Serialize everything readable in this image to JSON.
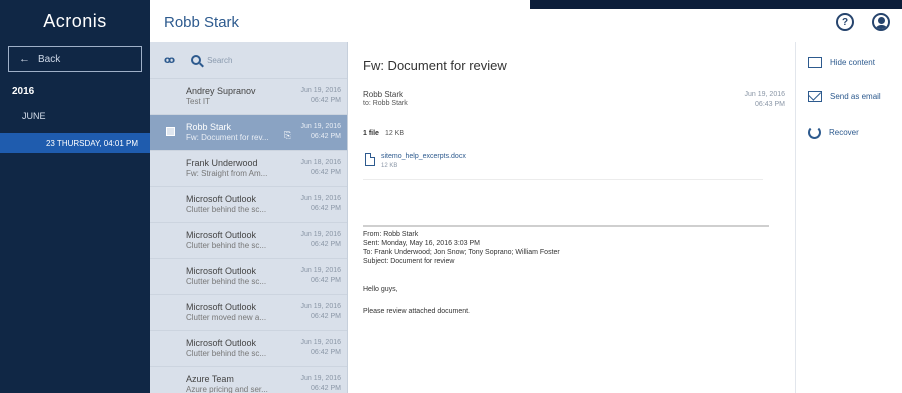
{
  "sidebar": {
    "brand": "Acronis",
    "back_label": "Back",
    "year": "2016",
    "month": "JUNE",
    "day": "23 THURSDAY, 04:01 PM"
  },
  "header": {
    "user_name": "Robb Stark"
  },
  "list": {
    "search_placeholder": "Search",
    "messages": [
      {
        "sender": "Andrey Supranov",
        "subject": "Test IT",
        "date": "Jun 19, 2016",
        "time": "06:42 PM"
      },
      {
        "sender": "Robb Stark",
        "subject": "Fw: Document for rev...",
        "date": "Jun 19, 2016",
        "time": "06:42 PM",
        "selected": true
      },
      {
        "sender": "Frank Underwood",
        "subject": "Fw: Straight from Am...",
        "date": "Jun 18, 2016",
        "time": "06:42 PM"
      },
      {
        "sender": "Microsoft Outlook",
        "subject": "Clutter behind the sc...",
        "date": "Jun 19, 2016",
        "time": "06:42 PM"
      },
      {
        "sender": "Microsoft Outlook",
        "subject": "Clutter behind the sc...",
        "date": "Jun 19, 2016",
        "time": "06:42 PM"
      },
      {
        "sender": "Microsoft Outlook",
        "subject": "Clutter behind the sc...",
        "date": "Jun 19, 2016",
        "time": "06:42 PM"
      },
      {
        "sender": "Microsoft Outlook",
        "subject": "Clutter moved new a...",
        "date": "Jun 19, 2016",
        "time": "06:42 PM"
      },
      {
        "sender": "Microsoft Outlook",
        "subject": "Clutter behind the sc...",
        "date": "Jun 19, 2016",
        "time": "06:42 PM"
      },
      {
        "sender": "Azure Team",
        "subject": "Azure pricing and ser...",
        "date": "Jun 19, 2016",
        "time": "06:42 PM"
      }
    ]
  },
  "mail": {
    "subject": "Fw: Document for review",
    "from": "Robb Stark",
    "to": "to: Robb Stark",
    "date": "Jun 19, 2016",
    "time": "06:43 PM",
    "files_count": "1 file",
    "files_size": "12 KB",
    "attachment_name": "sitemo_help_excerpts.docx",
    "attachment_size": "12 KB",
    "quote_from": "From: Robb Stark",
    "quote_sent": "Sent: Monday, May 16, 2016 3:03 PM",
    "quote_to": "To: Frank Underwood; Jon Snow; Tony Soprano; William Foster",
    "quote_subject": "Subject: Document for review",
    "body_hello": "Hello guys,",
    "body_please": "Please review attached document."
  },
  "actions": {
    "hide_content": "Hide content",
    "send_as_email": "Send as email",
    "recover": "Recover"
  }
}
